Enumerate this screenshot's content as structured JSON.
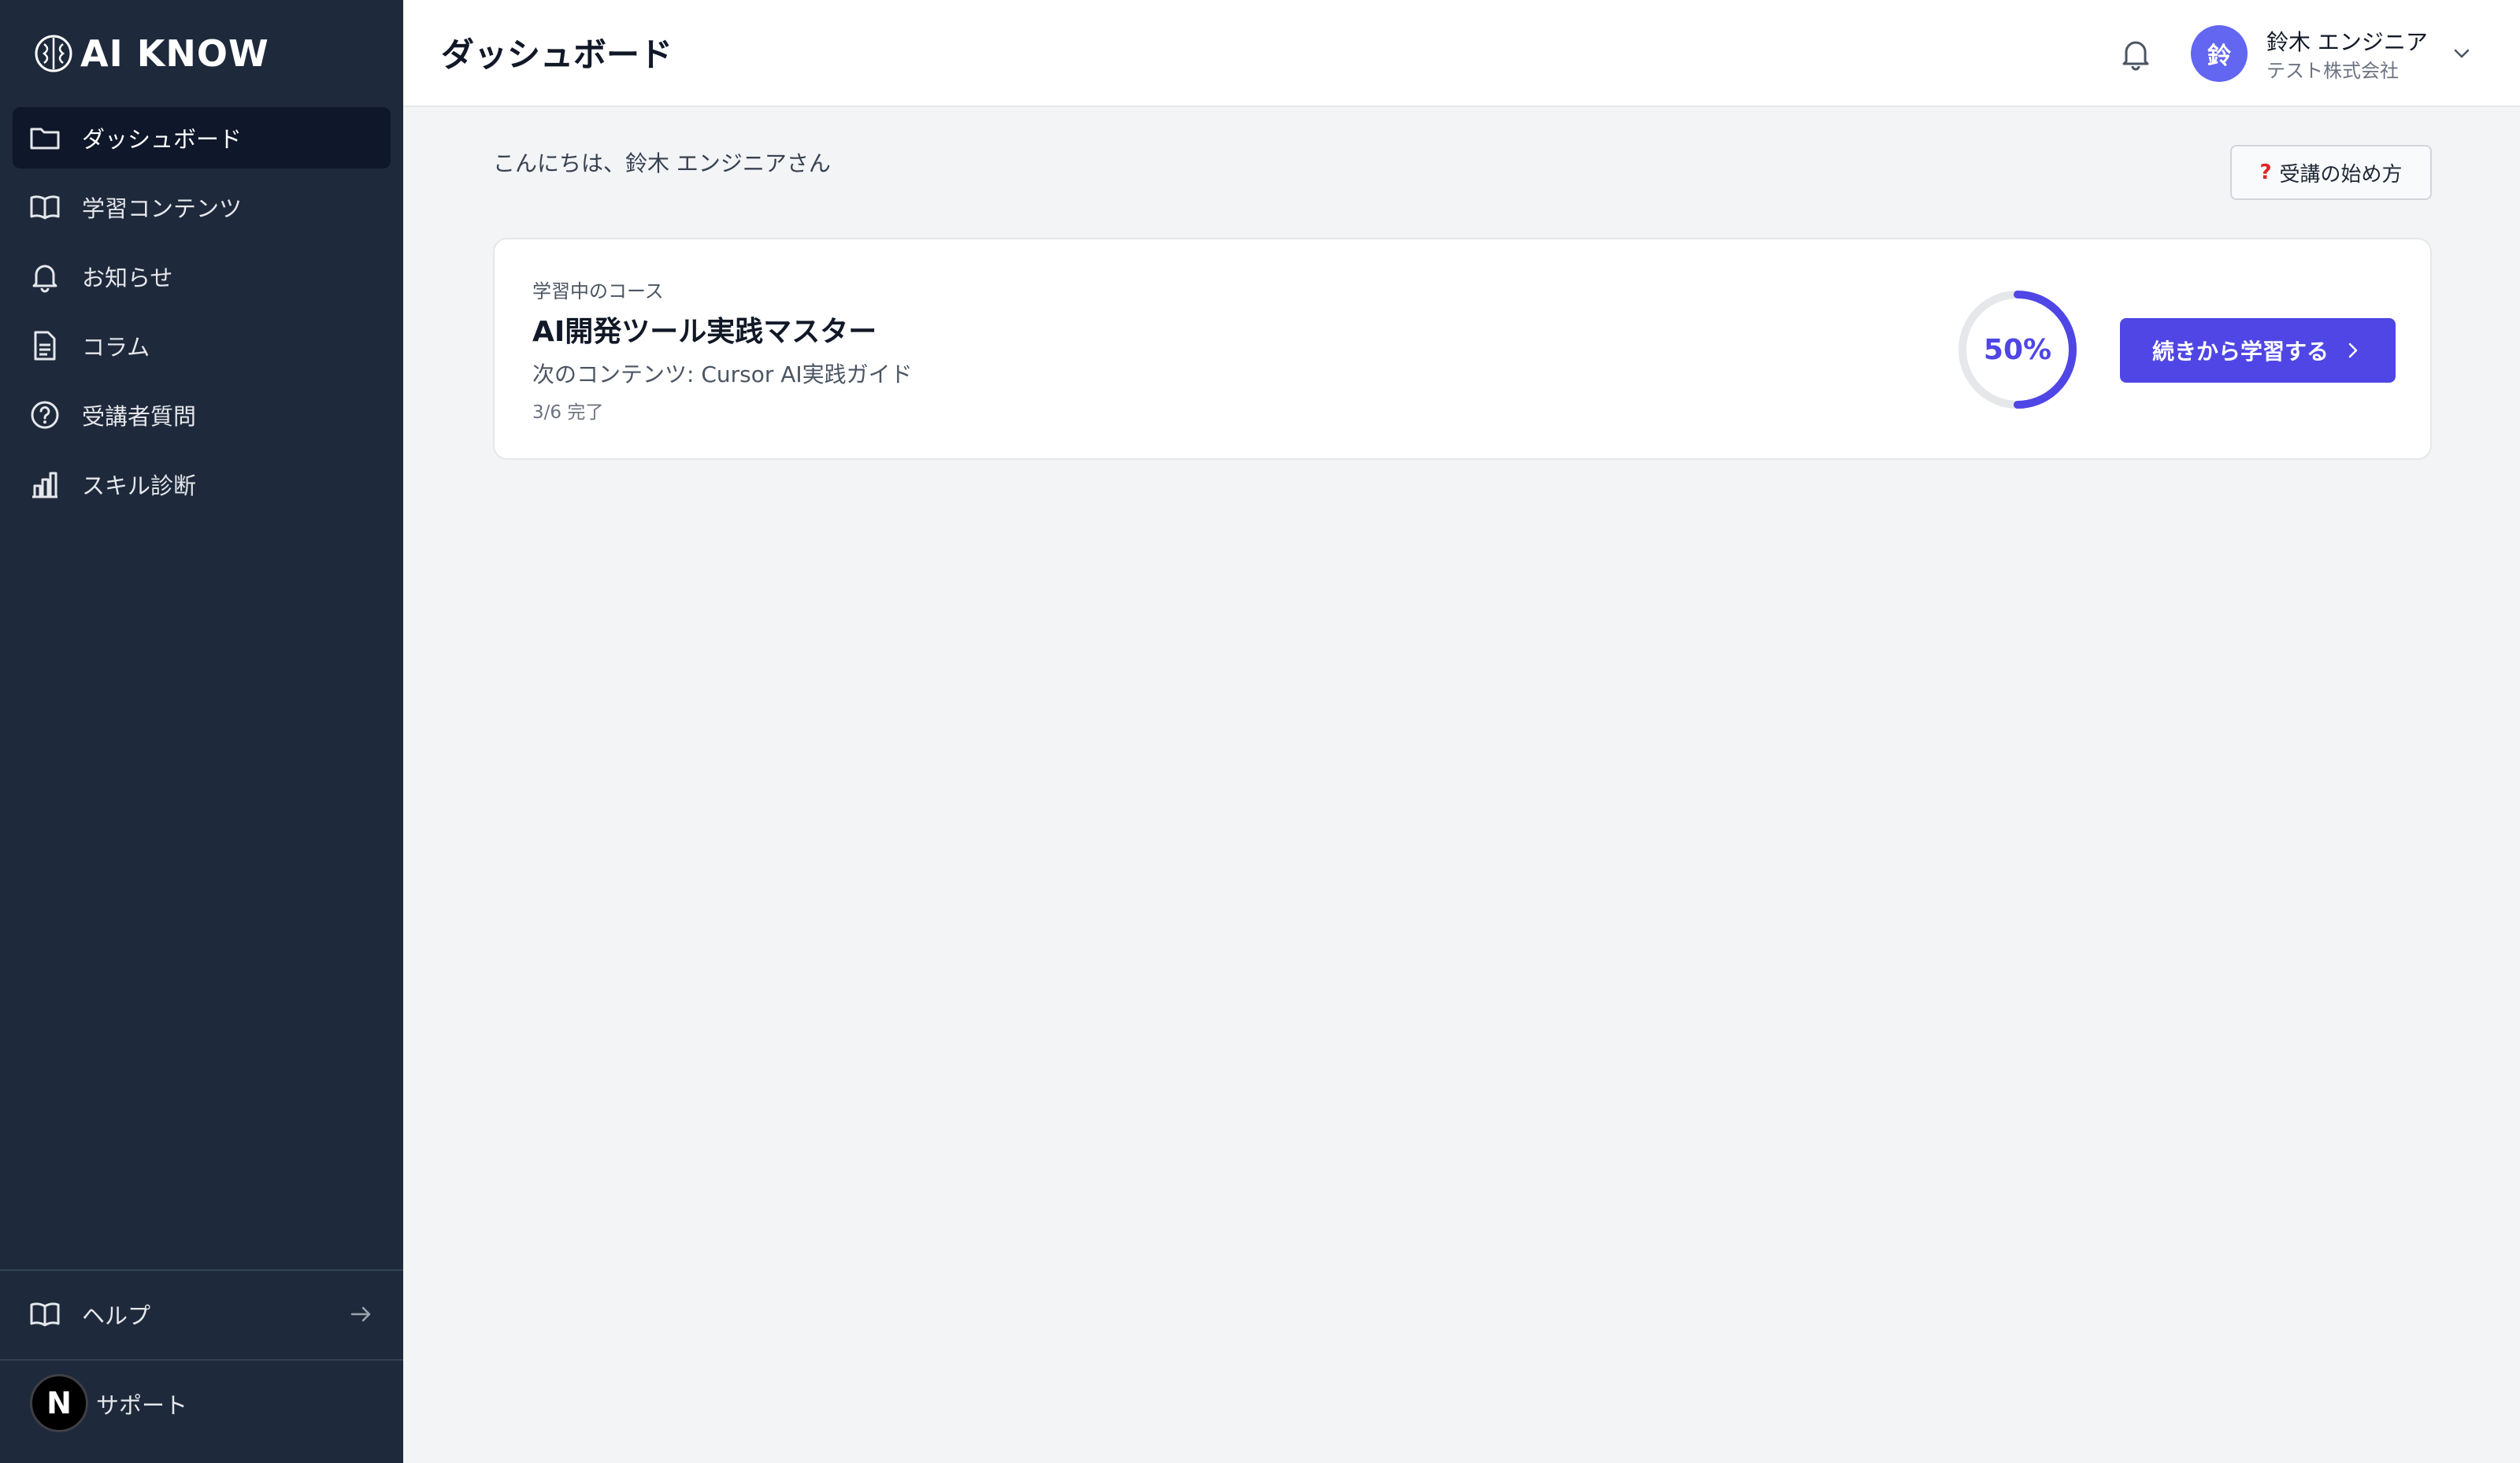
{
  "app": {
    "logo_text": "AI KNOW"
  },
  "sidebar": {
    "items": [
      {
        "label": "ダッシュボード",
        "icon": "folder-icon",
        "active": true
      },
      {
        "label": "学習コンテンツ",
        "icon": "book-open-icon"
      },
      {
        "label": "お知らせ",
        "icon": "bell-icon"
      },
      {
        "label": "コラム",
        "icon": "document-icon"
      },
      {
        "label": "受講者質問",
        "icon": "question-circle-icon"
      },
      {
        "label": "スキル診断",
        "icon": "bar-chart-icon"
      }
    ],
    "help_label": "ヘルプ",
    "support_label": "サポート",
    "support_badge": "N"
  },
  "header": {
    "title": "ダッシュボード",
    "user": {
      "initial": "鈴",
      "name": "鈴木 エンジニア",
      "company": "テスト株式会社"
    }
  },
  "main": {
    "greeting": "こんにちは、鈴木 エンジニアさん",
    "howto_icon": "?",
    "howto_label": "受講の始め方",
    "course": {
      "kicker": "学習中のコース",
      "title": "AI開発ツール実践マスター",
      "next": "次のコンテンツ: Cursor AI実践ガイド",
      "progress_text": "3/6 完了",
      "percent": 50,
      "percent_label": "50%",
      "continue_label": "続きから学習する"
    }
  },
  "colors": {
    "sidebar_bg": "#1e293b",
    "accent": "#4f46e5",
    "avatar": "#6366f1"
  }
}
